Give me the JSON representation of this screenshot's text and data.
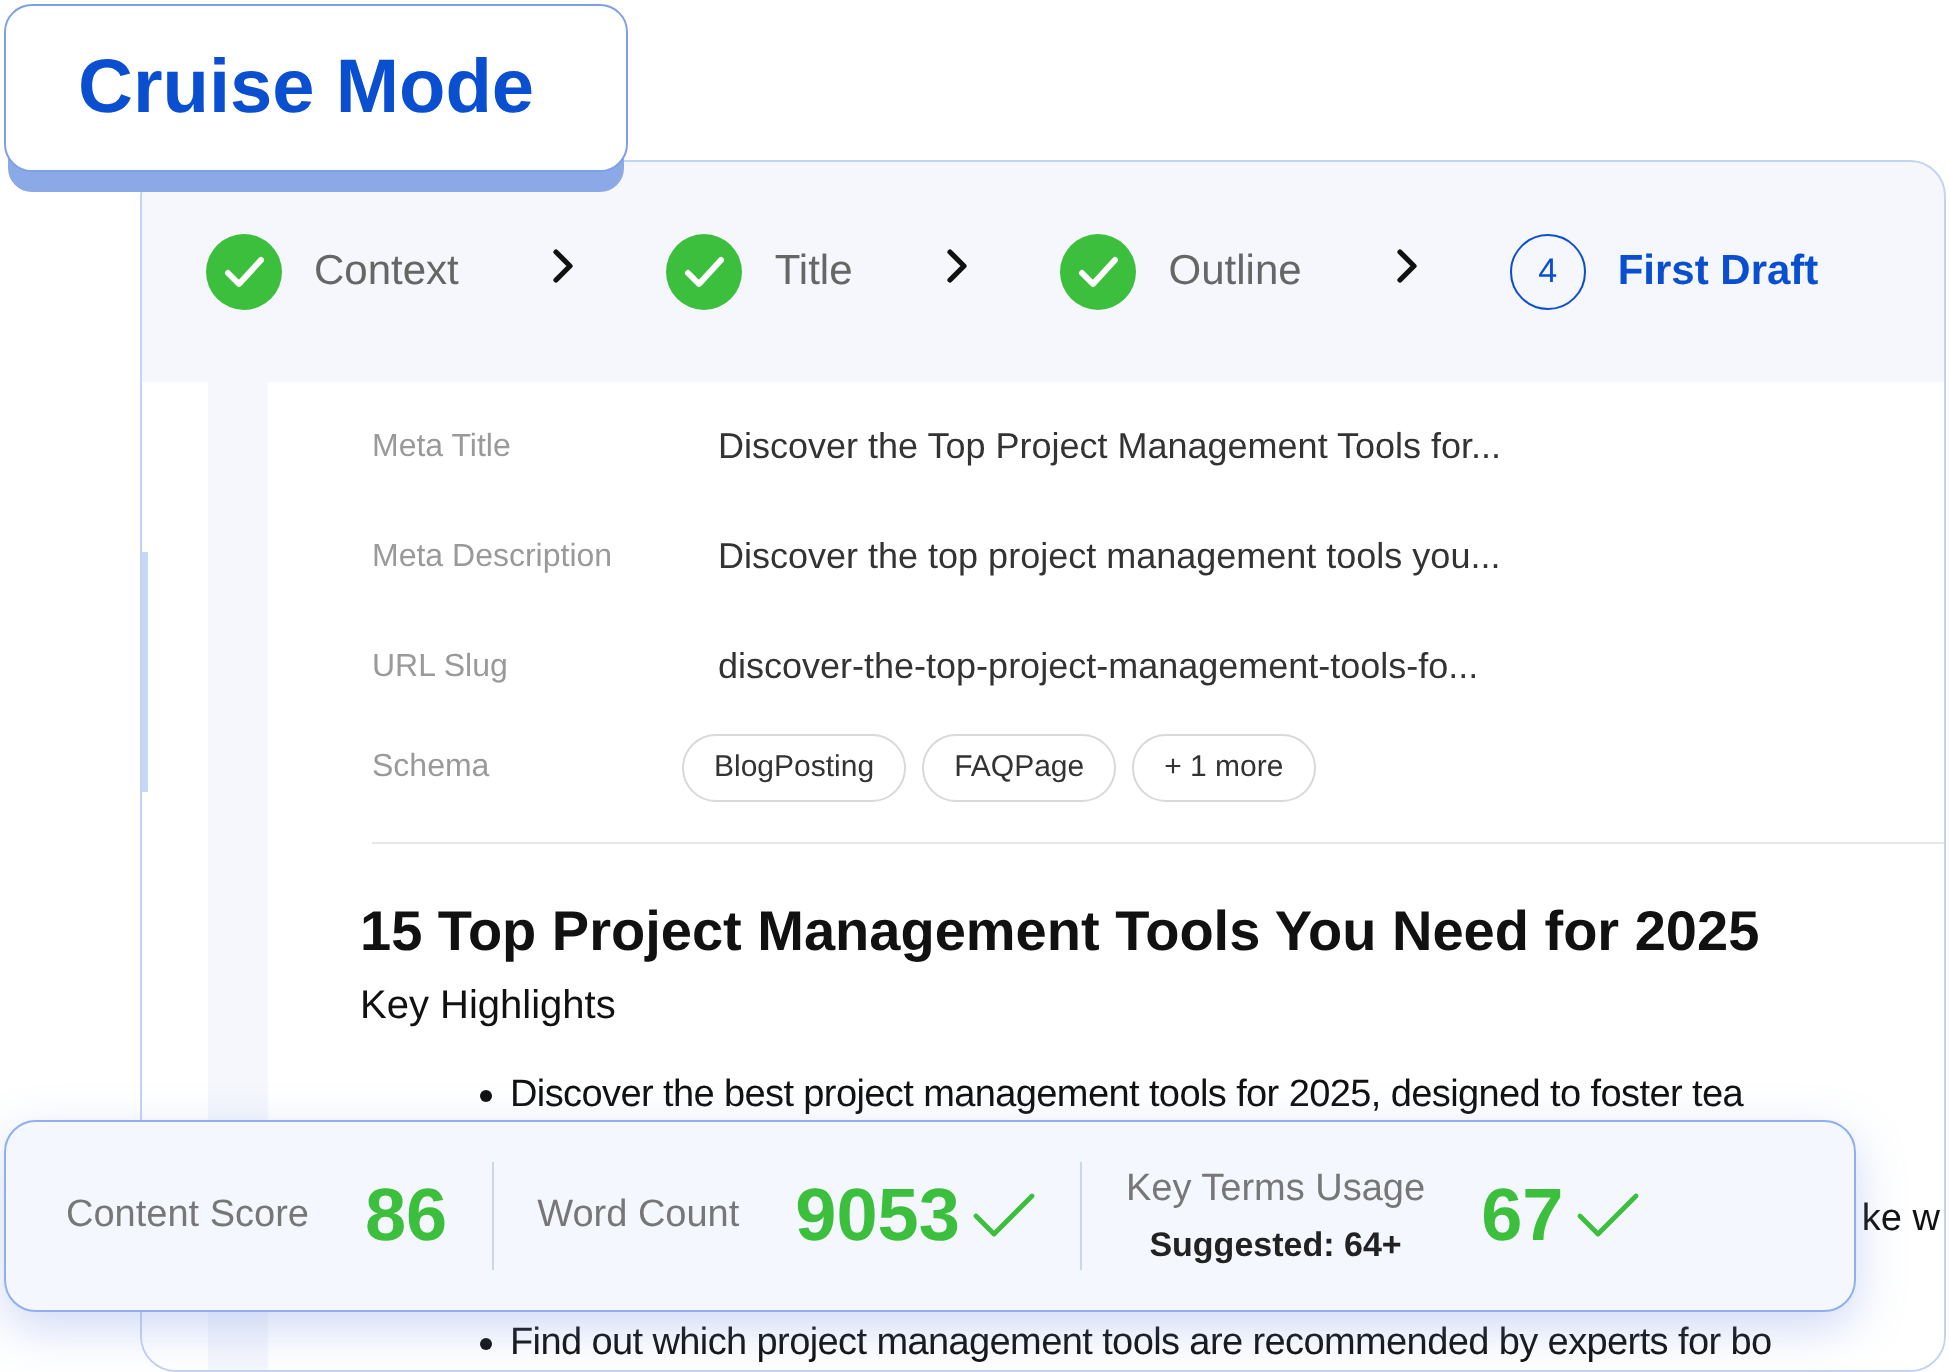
{
  "badge": {
    "label": "Cruise Mode"
  },
  "steps": [
    {
      "label": "Context",
      "completed": true,
      "selected": false
    },
    {
      "label": "Title",
      "completed": true,
      "selected": false
    },
    {
      "label": "Outline",
      "completed": true,
      "selected": false
    },
    {
      "label": "First Draft",
      "completed": false,
      "selected": true,
      "number": "4"
    }
  ],
  "meta": [
    {
      "label": "Meta Title",
      "value": "Discover the Top Project Management Tools for..."
    },
    {
      "label": "Meta Description",
      "value": "Discover the top project management tools you..."
    },
    {
      "label": "URL Slug",
      "value": "discover-the-top-project-management-tools-fo..."
    }
  ],
  "schema": {
    "label": "Schema",
    "tags": [
      "BlogPosting",
      "FAQPage",
      "+ 1 more"
    ]
  },
  "article": {
    "title": "15 Top Project Management Tools You Need for 2025",
    "subtitle": "Key Highlights",
    "bullets": [
      {
        "text": "Discover the best project management tools for 2025, designed to foster tea",
        "kind": "bullet"
      },
      {
        "text": "ke w",
        "kind": "fragment"
      },
      {
        "text": "Find out which project management tools are recommended by experts for bo",
        "kind": "bullet"
      }
    ]
  },
  "stats": [
    {
      "label": "Content Score",
      "value": "86",
      "checked": false
    },
    {
      "label": "Word Count",
      "value": "9053",
      "checked": true
    },
    {
      "label": "Key Terms Usage",
      "sublabel": "Suggested: 64+",
      "value": "67",
      "checked": true
    }
  ]
}
